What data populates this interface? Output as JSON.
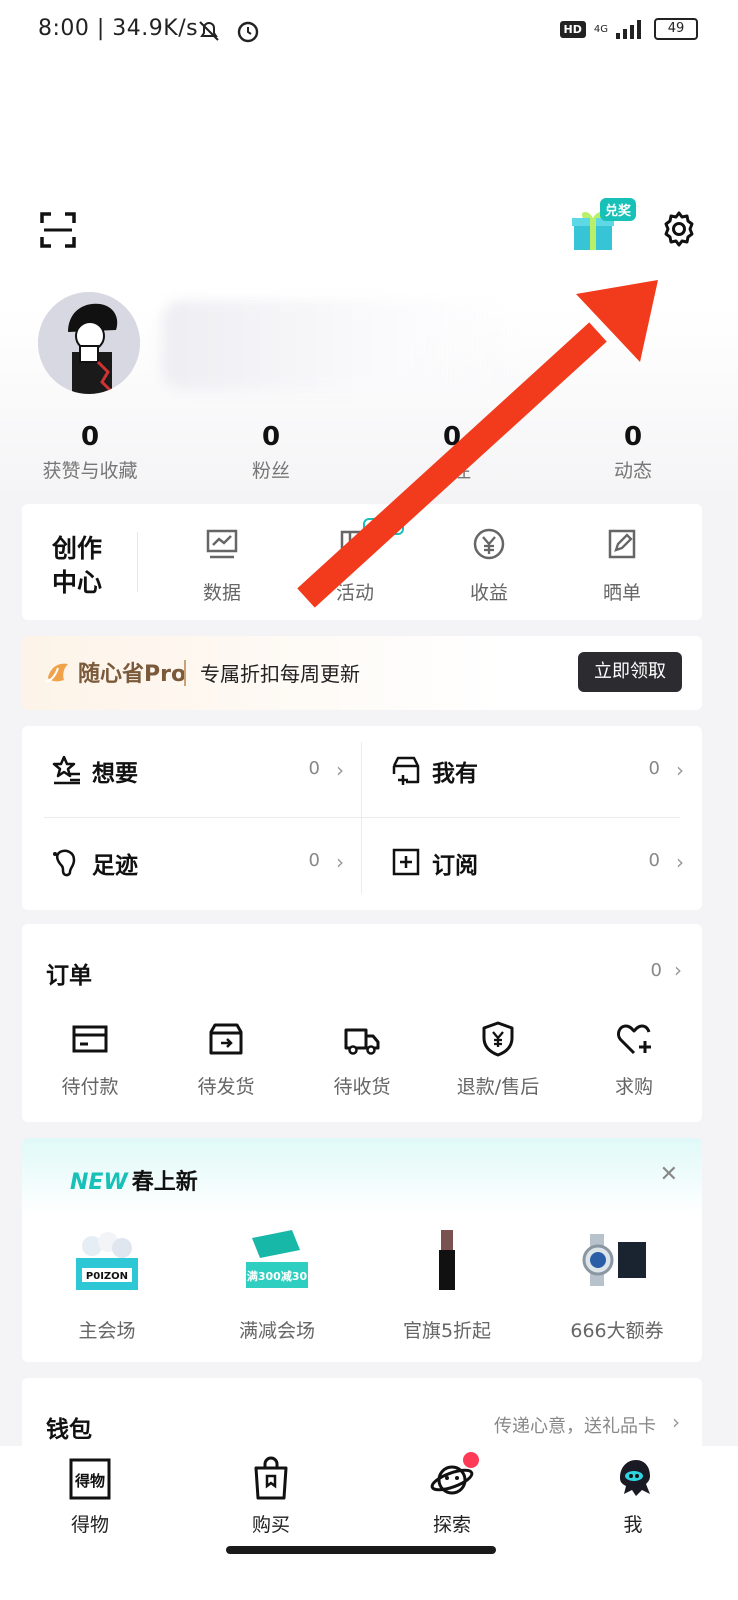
{
  "status_bar": {
    "left": "8:00 | 34.9K/s",
    "hd": "HD",
    "net": "4G",
    "battery": "49"
  },
  "header": {
    "gift_badge": "兑奖"
  },
  "stats": [
    {
      "value": "0",
      "label": "获赞与收藏"
    },
    {
      "value": "0",
      "label": "粉丝"
    },
    {
      "value": "0",
      "label": "关注"
    },
    {
      "value": "0",
      "label": "动态"
    }
  ],
  "creator": {
    "title": "创作中心",
    "new_badge": "NEW",
    "tools": [
      {
        "label": "数据",
        "icon": "data-chart-icon"
      },
      {
        "label": "活动",
        "icon": "activity-icon"
      },
      {
        "label": "收益",
        "icon": "yuan-coin-icon"
      },
      {
        "label": "晒单",
        "icon": "edit-note-icon"
      }
    ]
  },
  "promo": {
    "brand": "随心省Pro",
    "text": "专属折扣每周更新",
    "button": "立即领取"
  },
  "wants": [
    {
      "label": "想要",
      "count": "0",
      "icon": "star-list-icon"
    },
    {
      "label": "我有",
      "count": "0",
      "icon": "box-plus-icon"
    },
    {
      "label": "足迹",
      "count": "0",
      "icon": "footprint-icon"
    },
    {
      "label": "订阅",
      "count": "0",
      "icon": "subscribe-plus-icon"
    }
  ],
  "orders": {
    "title": "订单",
    "count": "0",
    "tools": [
      {
        "label": "待付款",
        "icon": "card-icon"
      },
      {
        "label": "待发货",
        "icon": "box-out-icon"
      },
      {
        "label": "待收货",
        "icon": "truck-icon"
      },
      {
        "label": "退款/售后",
        "icon": "shield-yuan-icon"
      },
      {
        "label": "求购",
        "icon": "heart-plus-icon"
      }
    ]
  },
  "spring": {
    "new_tag": "NEW",
    "title": "春上新",
    "items": [
      {
        "label": "主会场",
        "img_text": "P0IZON"
      },
      {
        "label": "满减会场",
        "img_text": "满300减30"
      },
      {
        "label": "官旗5折起"
      },
      {
        "label": "666大额券"
      }
    ]
  },
  "wallet": {
    "title": "钱包",
    "subtitle": "传递心意，送礼品卡"
  },
  "bottom_nav": [
    {
      "label": "得物",
      "icon_text": "得物"
    },
    {
      "label": "购买"
    },
    {
      "label": "探索"
    },
    {
      "label": "我"
    }
  ],
  "colors": {
    "accent_teal": "#18c1b7",
    "arrow_red": "#f23a1c",
    "dot_red": "#ff3a57"
  }
}
